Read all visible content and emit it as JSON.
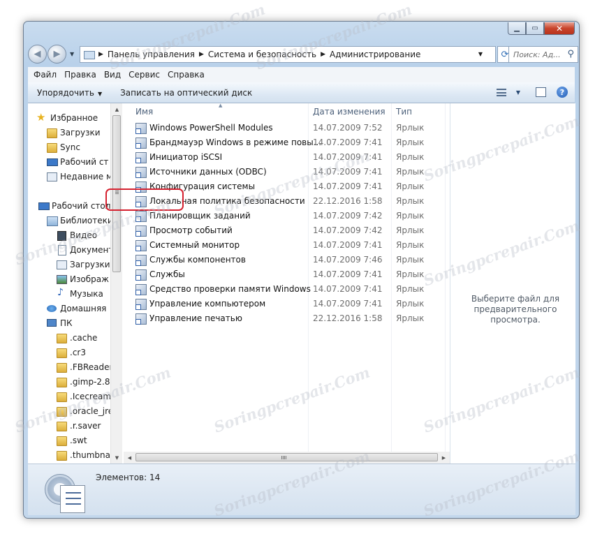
{
  "window": {
    "caption_buttons": [
      "minimize",
      "maximize",
      "close"
    ]
  },
  "nav": {
    "back_icon": "back-arrow-icon",
    "forward_icon": "forward-arrow-icon",
    "breadcrumb": [
      "Панель управления",
      "Система и безопасность",
      "Администрирование"
    ],
    "search_placeholder": "Поиск: Ад..."
  },
  "menu": [
    "Файл",
    "Правка",
    "Вид",
    "Сервис",
    "Справка"
  ],
  "toolbar": {
    "organize": "Упорядочить",
    "burn": "Записать на оптический диск"
  },
  "sidebar": {
    "items": [
      {
        "label": "Избранное",
        "icon": "star-icon"
      },
      {
        "label": "Загрузки",
        "icon": "folder-icon"
      },
      {
        "label": "Sync",
        "icon": "folder-icon"
      },
      {
        "label": "Рабочий ст",
        "icon": "desktop-icon"
      },
      {
        "label": "Недавние м",
        "icon": "recent-places-icon"
      },
      {
        "label": "Рабочий стол",
        "icon": "desktop-icon"
      },
      {
        "label": "Библиотеки",
        "icon": "libraries-icon"
      },
      {
        "label": "Видео",
        "icon": "video-icon"
      },
      {
        "label": "Документ",
        "icon": "documents-icon"
      },
      {
        "label": "Загрузки",
        "icon": "downloads-icon"
      },
      {
        "label": "Изображ",
        "icon": "pictures-icon"
      },
      {
        "label": "Музыка",
        "icon": "music-icon"
      },
      {
        "label": "Домашняя",
        "icon": "homegroup-icon"
      },
      {
        "label": "ПК",
        "icon": "computer-icon"
      },
      {
        "label": ".cache",
        "icon": "folder-icon"
      },
      {
        "label": ".cr3",
        "icon": "folder-icon"
      },
      {
        "label": ".FBReader",
        "icon": "folder-icon"
      },
      {
        "label": ".gimp-2.8",
        "icon": "folder-icon"
      },
      {
        "label": ".Icecream",
        "icon": "folder-icon"
      },
      {
        "label": ".oracle_jre",
        "icon": "folder-icon"
      },
      {
        "label": ".r.saver",
        "icon": "folder-icon"
      },
      {
        "label": ".swt",
        "icon": "folder-icon"
      },
      {
        "label": ".thumbna",
        "icon": "folder-icon"
      }
    ]
  },
  "columns": {
    "name": "Имя",
    "date": "Дата изменения",
    "type": "Тип"
  },
  "files": [
    {
      "name": "Windows PowerShell Modules",
      "date": "14.07.2009 7:52",
      "type": "Ярлык"
    },
    {
      "name": "Брандмауэр Windows в режиме повы...",
      "date": "14.07.2009 7:41",
      "type": "Ярлык"
    },
    {
      "name": "Инициатор iSCSI",
      "date": "14.07.2009 7:41",
      "type": "Ярлык"
    },
    {
      "name": "Источники данных (ODBC)",
      "date": "14.07.2009 7:41",
      "type": "Ярлык"
    },
    {
      "name": "Конфигурация системы",
      "date": "14.07.2009 7:41",
      "type": "Ярлык"
    },
    {
      "name": "Локальная политика безопасности",
      "date": "22.12.2016 1:58",
      "type": "Ярлык"
    },
    {
      "name": "Планировщик заданий",
      "date": "14.07.2009 7:42",
      "type": "Ярлык"
    },
    {
      "name": "Просмотр событий",
      "date": "14.07.2009 7:42",
      "type": "Ярлык"
    },
    {
      "name": "Системный монитор",
      "date": "14.07.2009 7:41",
      "type": "Ярлык"
    },
    {
      "name": "Службы компонентов",
      "date": "14.07.2009 7:46",
      "type": "Ярлык"
    },
    {
      "name": "Службы",
      "date": "14.07.2009 7:41",
      "type": "Ярлык"
    },
    {
      "name": "Средство проверки памяти Windows",
      "date": "14.07.2009 7:41",
      "type": "Ярлык"
    },
    {
      "name": "Управление компьютером",
      "date": "14.07.2009 7:41",
      "type": "Ярлык"
    },
    {
      "name": "Управление печатью",
      "date": "22.12.2016 1:58",
      "type": "Ярлык"
    }
  ],
  "preview": {
    "line1": "Выберите файл для",
    "line2": "предварительного просмотра."
  },
  "status": {
    "items_count": "Элементов: 14"
  },
  "watermark": "Soringpcrepair.Com",
  "colors": {
    "highlight": "#d5212f",
    "window_frame": "#b9d1ea"
  }
}
